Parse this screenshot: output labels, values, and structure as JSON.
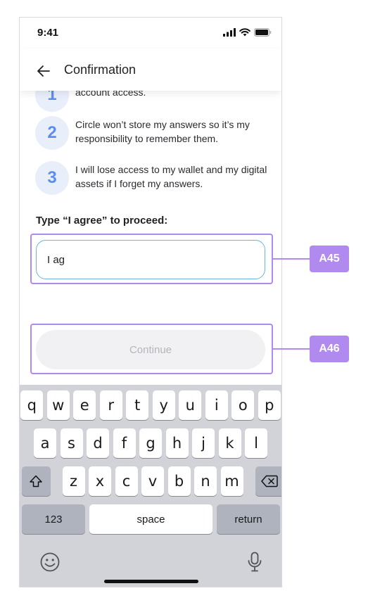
{
  "status_bar": {
    "time": "9:41"
  },
  "header": {
    "title": "Confirmation"
  },
  "steps": [
    {
      "number": "1",
      "text": "account access."
    },
    {
      "number": "2",
      "text": "Circle won’t store my answers so it’s my responsibility to remember them."
    },
    {
      "number": "3",
      "text": "I will lose access to my wallet and my digital assets if I forget my answers."
    }
  ],
  "agree": {
    "label": "Type “I agree” to proceed:",
    "value": "I ag"
  },
  "continue_label": "Continue",
  "keyboard": {
    "row1": [
      "q",
      "w",
      "e",
      "r",
      "t",
      "y",
      "u",
      "i",
      "o",
      "p"
    ],
    "row2": [
      "a",
      "s",
      "d",
      "f",
      "g",
      "h",
      "j",
      "k",
      "l"
    ],
    "row3": [
      "z",
      "x",
      "c",
      "v",
      "b",
      "n",
      "m"
    ],
    "numbers_label": "123",
    "space_label": "space",
    "return_label": "return"
  },
  "annotations": {
    "input_tag": "A45",
    "button_tag": "A46"
  },
  "colors": {
    "accent": "#5b8ef0",
    "annotation": "#b18af0",
    "input_border": "#6db4dd"
  },
  "icons": [
    "back-arrow-icon",
    "signal-icon",
    "wifi-icon",
    "battery-icon",
    "shift-icon",
    "backspace-icon",
    "emoji-icon",
    "microphone-icon"
  ]
}
